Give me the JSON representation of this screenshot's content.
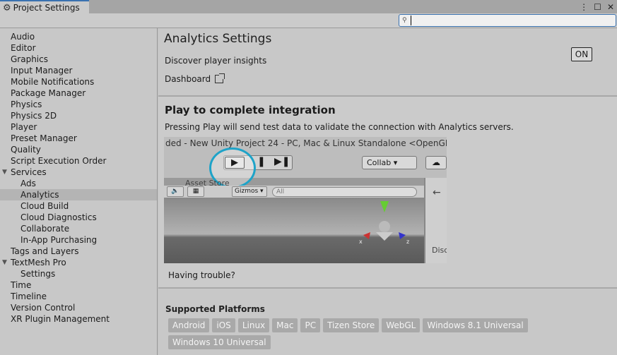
{
  "window": {
    "tab_title": "Project Settings",
    "controls": [
      "⋮",
      "☐",
      "✕"
    ]
  },
  "search": {
    "value": "",
    "placeholder": ""
  },
  "sidebar": {
    "items": [
      {
        "label": "Audio",
        "level": 0
      },
      {
        "label": "Editor",
        "level": 0
      },
      {
        "label": "Graphics",
        "level": 0
      },
      {
        "label": "Input Manager",
        "level": 0
      },
      {
        "label": "Mobile Notifications",
        "level": 0
      },
      {
        "label": "Package Manager",
        "level": 0
      },
      {
        "label": "Physics",
        "level": 0
      },
      {
        "label": "Physics 2D",
        "level": 0
      },
      {
        "label": "Player",
        "level": 0
      },
      {
        "label": "Preset Manager",
        "level": 0
      },
      {
        "label": "Quality",
        "level": 0
      },
      {
        "label": "Script Execution Order",
        "level": 0
      },
      {
        "label": "Services",
        "level": 0,
        "expanded": true
      },
      {
        "label": "Ads",
        "level": 1
      },
      {
        "label": "Analytics",
        "level": 1,
        "selected": true
      },
      {
        "label": "Cloud Build",
        "level": 1
      },
      {
        "label": "Cloud Diagnostics",
        "level": 1
      },
      {
        "label": "Collaborate",
        "level": 1
      },
      {
        "label": "In-App Purchasing",
        "level": 1
      },
      {
        "label": "Tags and Layers",
        "level": 0
      },
      {
        "label": "TextMesh Pro",
        "level": 0,
        "expanded": true
      },
      {
        "label": "Settings",
        "level": 1
      },
      {
        "label": "Time",
        "level": 0
      },
      {
        "label": "Timeline",
        "level": 0
      },
      {
        "label": "Version Control",
        "level": 0
      },
      {
        "label": "XR Plugin Management",
        "level": 0
      }
    ]
  },
  "main": {
    "title": "Analytics Settings",
    "description": "Discover player insights",
    "dashboard_link": "Dashboard",
    "toggle_label": "ON",
    "integration": {
      "heading": "Play to complete integration",
      "text": "Pressing Play will send test data to validate the connection with Analytics servers.",
      "video": {
        "window_title": "ded - New Unity Project 24 - PC, Mac & Linux Standalone <OpenGL",
        "collab_label": "Collab ▾",
        "asset_store_label": "Asset Store",
        "gizmos_label": "Gizmos ▾",
        "search_label": "All",
        "side_label": "Disc"
      },
      "trouble_text": "Having trouble?"
    },
    "platforms": {
      "heading": "Supported Platforms",
      "items": [
        "Android",
        "iOS",
        "Linux",
        "Mac",
        "PC",
        "Tizen Store",
        "WebGL",
        "Windows 8.1 Universal",
        "Windows 10 Universal"
      ]
    }
  },
  "icons": {
    "gear": "⚙",
    "search": "🔍",
    "external_link": "external-link-icon",
    "fold_open": "▼",
    "play": "▶",
    "pause": "❚❚",
    "step": "▶❚"
  },
  "colors": {
    "accent": "#3a72b0",
    "highlight_ring": "#1ea3c8",
    "selected_row": "#b4b4b4",
    "chip_bg": "#a9a9a9"
  }
}
